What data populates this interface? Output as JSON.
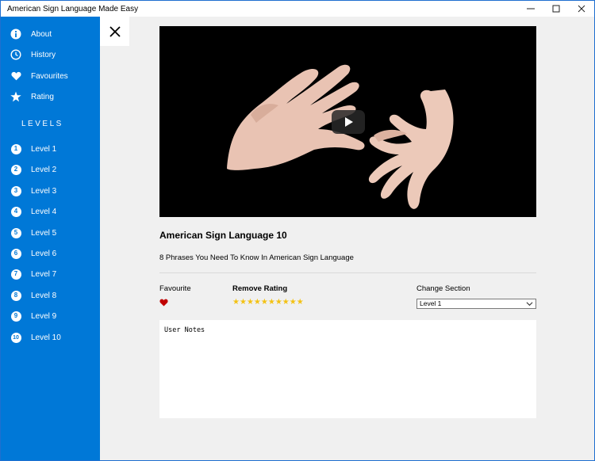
{
  "window": {
    "title": "American Sign Language Made Easy",
    "minimize_glyph": "—",
    "maximize_glyph": "☐",
    "close_glyph": "✕"
  },
  "sidebar": {
    "background": "#0078d7",
    "items": [
      {
        "label": "About",
        "icon": "info-icon"
      },
      {
        "label": "History",
        "icon": "clock-icon"
      },
      {
        "label": "Favourites",
        "icon": "heart-icon"
      },
      {
        "label": "Rating",
        "icon": "star-icon"
      }
    ],
    "levels_heading": "LEVELS",
    "levels": [
      {
        "num": "1",
        "label": "Level 1"
      },
      {
        "num": "2",
        "label": "Level 2"
      },
      {
        "num": "3",
        "label": "Level 3"
      },
      {
        "num": "4",
        "label": "Level 4"
      },
      {
        "num": "5",
        "label": "Level 5"
      },
      {
        "num": "6",
        "label": "Level 6"
      },
      {
        "num": "7",
        "label": "Level 7"
      },
      {
        "num": "8",
        "label": "Level 8"
      },
      {
        "num": "9",
        "label": "Level 9"
      },
      {
        "num": "10",
        "label": "Level 10"
      }
    ]
  },
  "main": {
    "close_icon": "close-icon",
    "video": {
      "play_icon": "play-icon"
    },
    "lesson_title": "American Sign Language 10",
    "lesson_subtitle": "8 Phrases You Need To Know In American Sign Language",
    "favourite_label": "Favourite",
    "favourite_color": "#c00000",
    "rating_label": "Remove Rating",
    "rating": {
      "value": 10,
      "max": 10,
      "color": "#f3c214"
    },
    "section_label": "Change Section",
    "section_selected": "Level 1",
    "notes_placeholder": "User Notes"
  }
}
